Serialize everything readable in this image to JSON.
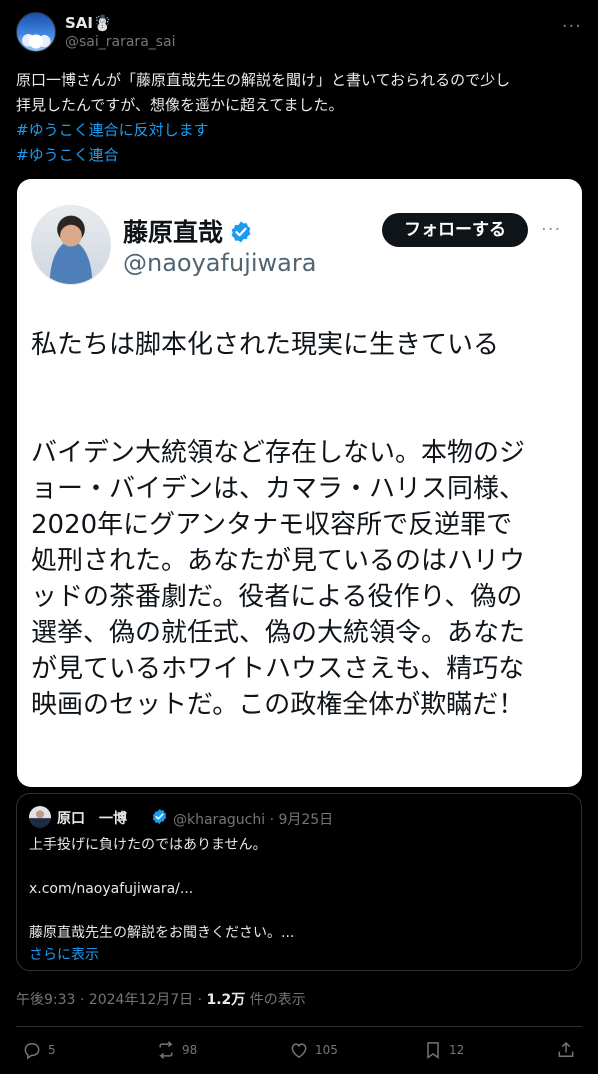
{
  "author": {
    "name": "SAI☃️",
    "handle": "@sai_rarara_sai",
    "more_icon": "more-horizontal-icon"
  },
  "tweet": {
    "lines": [
      "原口一博さんが「藤原直哉先生の解説を聞け」と書いておられるので少し",
      "拝見したんですが、想像を遥かに超えてました。"
    ],
    "hashtags": [
      "#ゆうこく連合に反対します",
      "#ゆうこく連合"
    ]
  },
  "media": {
    "name": "藤原直哉",
    "handle": "@naoyafujiwara",
    "follow_label": "フォローする",
    "body_first": "私たちは脚本化された現実に生きている",
    "body_lines": [
      "バイデン大統領など存在しない。本物のジ",
      "ョー・バイデンは、カマラ・ハリス同様、",
      "2020年にグアンタナモ収容所で反逆罪で",
      "処刑された。あなたが見ているのはハリウ",
      "ッドの茶番劇だ。役者による役作り、偽の",
      "選挙、偽の就任式、偽の大統領令。あなた",
      "が見ているホワイトハウスさえも、精巧な",
      "映画のセットだ。この政権全体が欺瞞だ！"
    ]
  },
  "quote": {
    "name": "原口　一博",
    "handle": "@kharaguchi · 9月25日",
    "lines": [
      "上手投げに負けたのではありません。",
      "",
      "x.com/naoyafujiwara/...",
      "",
      "藤原直哉先生の解説をお聞きください。..."
    ],
    "show_more": "さらに表示"
  },
  "meta": {
    "time": "午後9:33 · 2024年12月7日 · ",
    "views": "1.2万",
    "views_suffix": " 件の表示"
  },
  "actions": {
    "replies": "5",
    "retweets": "98",
    "likes": "105",
    "bookmarks": "12"
  },
  "colors": {
    "accent": "#1d9bf0",
    "background": "#000000",
    "verified": "#1d9bf0"
  }
}
